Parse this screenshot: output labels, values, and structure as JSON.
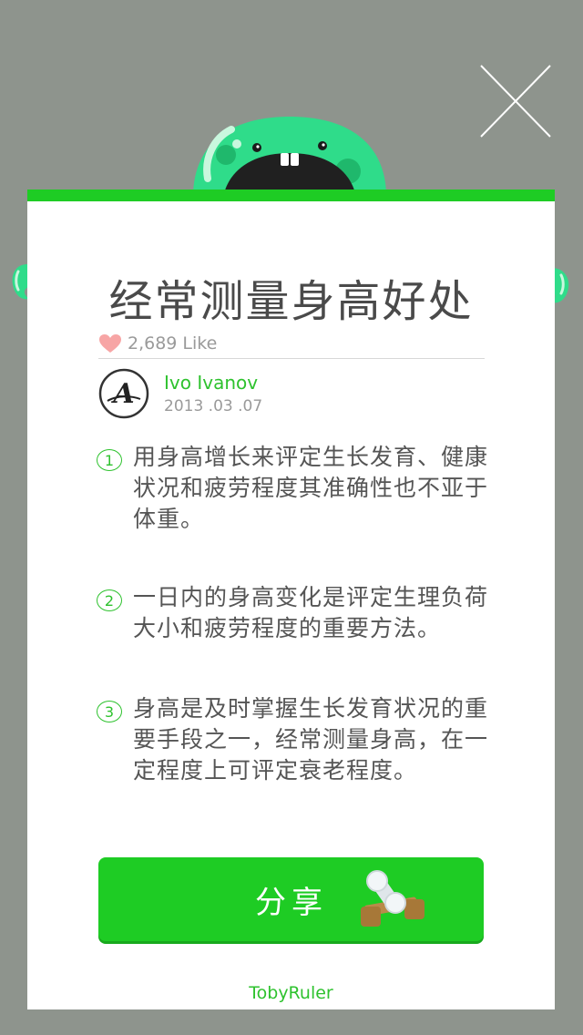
{
  "header": {
    "close_icon": "close-x-icon",
    "mascot": "green-monster-icon"
  },
  "article": {
    "title": "经常测量身高好处",
    "likes": "2,689 Like",
    "like_icon": "heart-icon"
  },
  "author": {
    "name": "Ivo Ivanov",
    "date": "2013 .03 .07",
    "avatar_letter": "A"
  },
  "points": [
    {
      "num": "1",
      "text": "用身高增长来评定生长发育、健康状况和疲劳程度其准确性也不亚于体重。"
    },
    {
      "num": "2",
      "text": "一日内的身高变化是评定生理负荷大小和疲劳程度的重要方法。"
    },
    {
      "num": "3",
      "text": "身高是及时掌握生长发育状况的重要手段之一，经常测量身高，在一定程度上可评定衰老程度。"
    }
  ],
  "share": {
    "label": "分享",
    "icon": "dumbbell-icon"
  },
  "footer": {
    "brand": "TobyRuler"
  },
  "colors": {
    "accent": "#1ecc24",
    "background": "#8e948d",
    "monster": "#2fdc8a",
    "heart": "#f7a5a5"
  }
}
